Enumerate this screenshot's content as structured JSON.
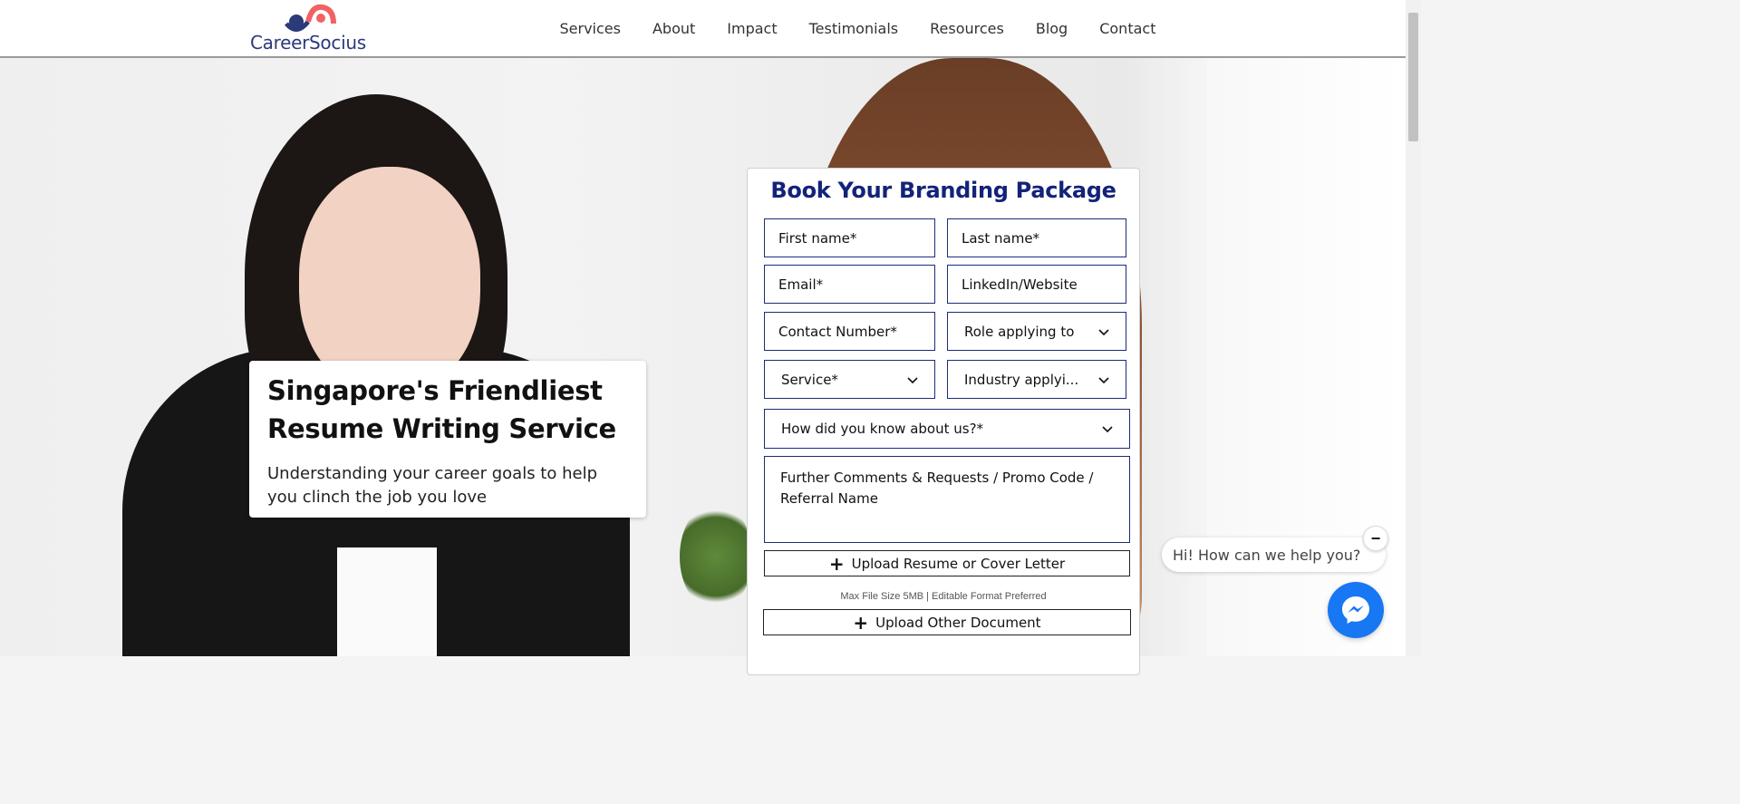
{
  "logo": {
    "text": "CareerSocius",
    "mark_icon": "career-socius-logo-mark"
  },
  "nav": {
    "items": [
      {
        "label": "Services"
      },
      {
        "label": "About"
      },
      {
        "label": "Impact"
      },
      {
        "label": "Testimonials"
      },
      {
        "label": "Resources"
      },
      {
        "label": "Blog"
      },
      {
        "label": "Contact"
      }
    ]
  },
  "hero": {
    "title": "Singapore's Friendliest Resume Writing Service",
    "subtitle": "Understanding your career goals to help you clinch the job you love"
  },
  "form": {
    "title": "Book Your Branding Package",
    "first_name_placeholder": "First name*",
    "last_name_placeholder": "Last name*",
    "email_placeholder": "Email*",
    "linkedin_placeholder": "LinkedIn/Website",
    "contact_placeholder": "Contact Number*",
    "role_select": "Role applying to",
    "service_select": "Service*",
    "industry_select": "Industry applyi...",
    "source_select": "How did you know about us?*",
    "comments_placeholder": "Further Comments & Requests / Promo Code / Referral Name",
    "upload_resume_label": "Upload Resume or Cover Letter",
    "upload_note": "Max File Size 5MB | Editable Format Preferred",
    "upload_other_label": "Upload Other Document"
  },
  "chat": {
    "greeting": "Hi! How can we help you?",
    "minimize_symbol": "−",
    "messenger_icon": "messenger-icon"
  },
  "colors": {
    "brand_navy": "#13237a",
    "logo_coral": "#f06363",
    "messenger_blue": "#1877f2",
    "field_border": "#1c2c7a"
  }
}
